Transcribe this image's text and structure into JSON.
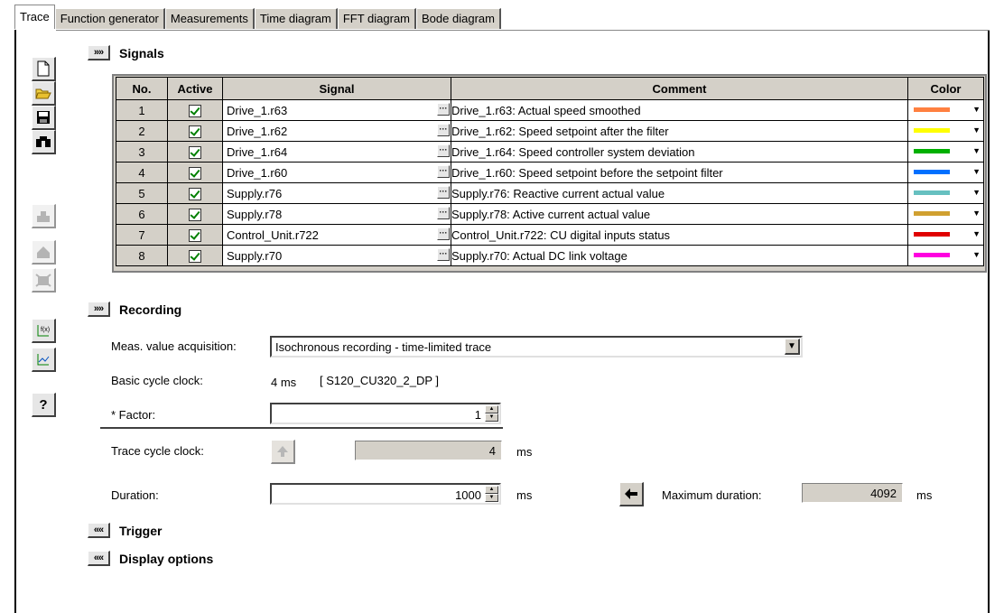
{
  "tabs": [
    "Trace",
    "Function generator",
    "Measurements",
    "Time diagram",
    "FFT diagram",
    "Bode diagram"
  ],
  "signals": {
    "title": "Signals",
    "expand_label": "»",
    "columns": {
      "no": "No.",
      "active": "Active",
      "signal": "Signal",
      "comment": "Comment",
      "color": "Color"
    },
    "rows": [
      {
        "no": "1",
        "signal": "Drive_1.r63",
        "comment": "Drive_1.r63: Actual speed smoothed",
        "color": "#ff8040"
      },
      {
        "no": "2",
        "signal": "Drive_1.r62",
        "comment": "Drive_1.r62: Speed setpoint after the filter",
        "color": "#ffff00"
      },
      {
        "no": "3",
        "signal": "Drive_1.r64",
        "comment": "Drive_1.r64: Speed controller system deviation",
        "color": "#00b000"
      },
      {
        "no": "4",
        "signal": "Drive_1.r60",
        "comment": "Drive_1.r60: Speed setpoint before the setpoint filter",
        "color": "#0070ff"
      },
      {
        "no": "5",
        "signal": "Supply.r76",
        "comment": "Supply.r76: Reactive current actual value",
        "color": "#66c0c0"
      },
      {
        "no": "6",
        "signal": "Supply.r78",
        "comment": "Supply.r78: Active current actual value",
        "color": "#d0a030"
      },
      {
        "no": "7",
        "signal": "Control_Unit.r722",
        "comment": "Control_Unit.r722: CU digital inputs status",
        "color": "#e00000"
      },
      {
        "no": "8",
        "signal": "Supply.r70",
        "comment": "Supply.r70: Actual DC link voltage",
        "color": "#ff00e0"
      }
    ]
  },
  "recording": {
    "title": "Recording",
    "meas_label": "Meas. value acquisition:",
    "meas_value": "Isochronous recording - time-limited trace",
    "basic_cycle_label": "Basic cycle clock:",
    "basic_cycle_value": "4 ms",
    "device": "[ S120_CU320_2_DP ]",
    "factor_label": "* Factor:",
    "factor_value": "1",
    "trace_cycle_label": "Trace cycle clock:",
    "trace_cycle_value": "4",
    "trace_cycle_unit": "ms",
    "duration_label": "Duration:",
    "duration_value": "1000",
    "duration_unit": "ms",
    "max_duration_label": "Maximum duration:",
    "max_duration_value": "4092",
    "max_duration_unit": "ms"
  },
  "trigger": {
    "title": "Trigger",
    "collapse_label": "«"
  },
  "display_options": {
    "title": "Display options",
    "collapse_label": "«"
  },
  "toolbar": {
    "help_label": "?"
  }
}
